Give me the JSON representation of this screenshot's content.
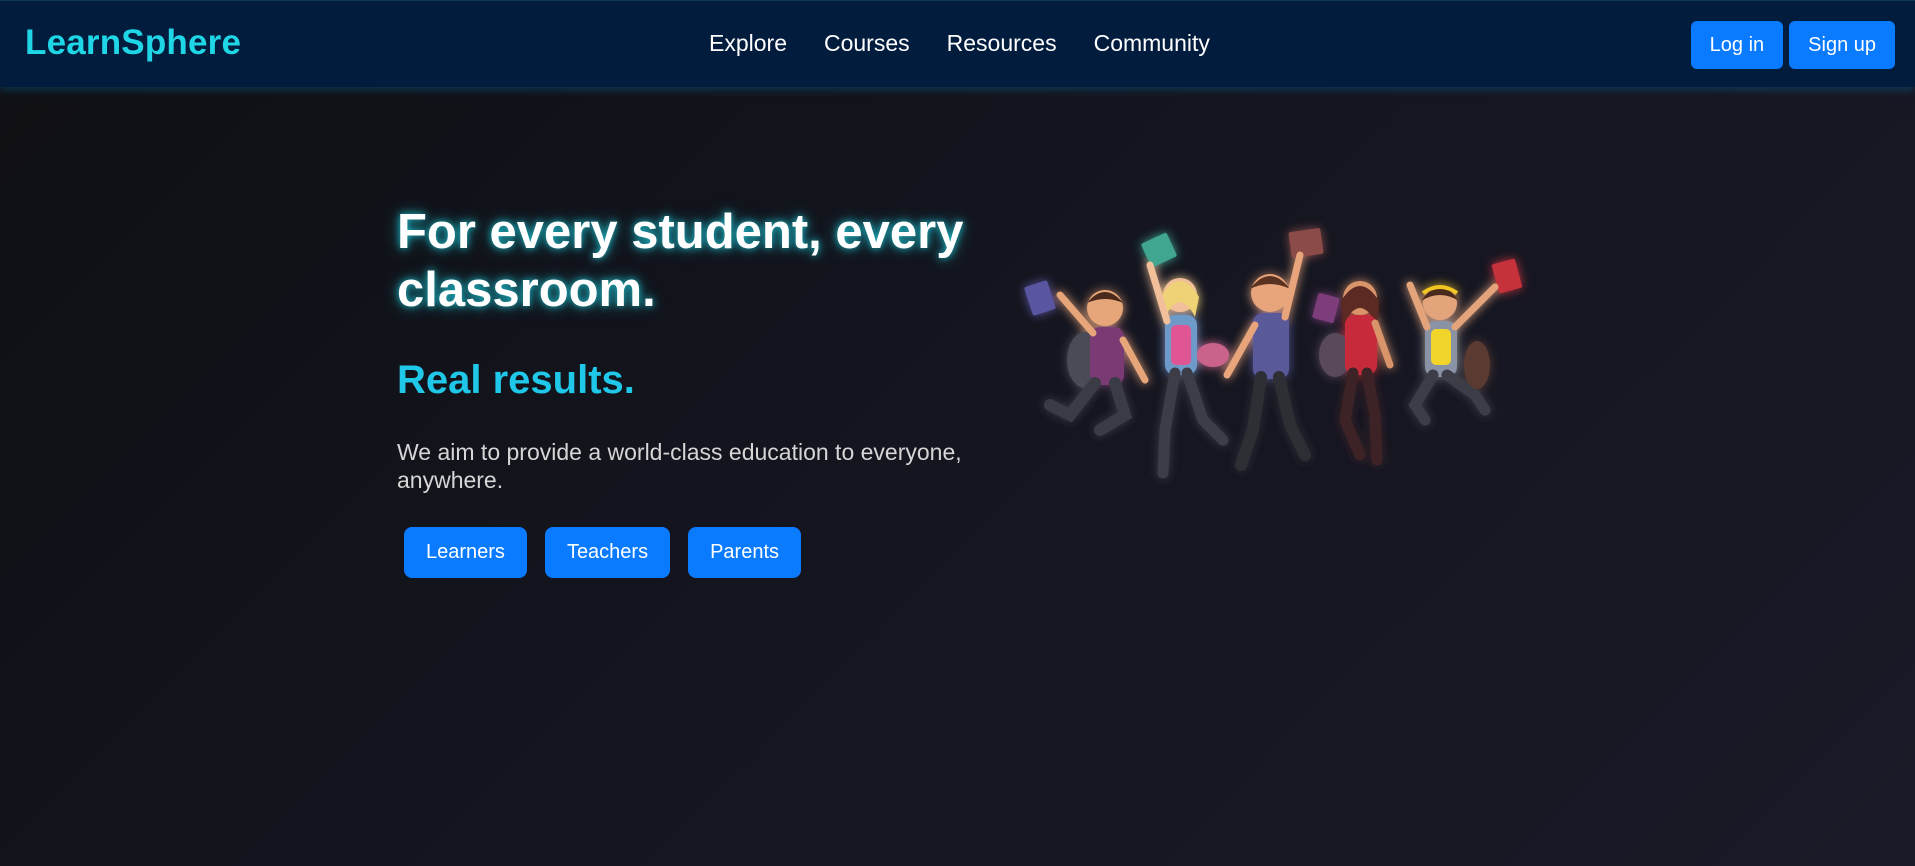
{
  "brand": {
    "name": "LearnSphere",
    "color": "#1fd6e6"
  },
  "nav": {
    "links": [
      "Explore",
      "Courses",
      "Resources",
      "Community"
    ],
    "login_label": "Log in",
    "signup_label": "Sign up",
    "background": "#021c3d"
  },
  "hero": {
    "title": "For every student, every classroom.",
    "subtitle": "Real results.",
    "description": "We aim to provide a world-class education to everyone, anywhere.",
    "buttons": [
      "Learners",
      "Teachers",
      "Parents"
    ],
    "accent": "#0a7bff",
    "illustration": "jumping-students-illustration"
  }
}
